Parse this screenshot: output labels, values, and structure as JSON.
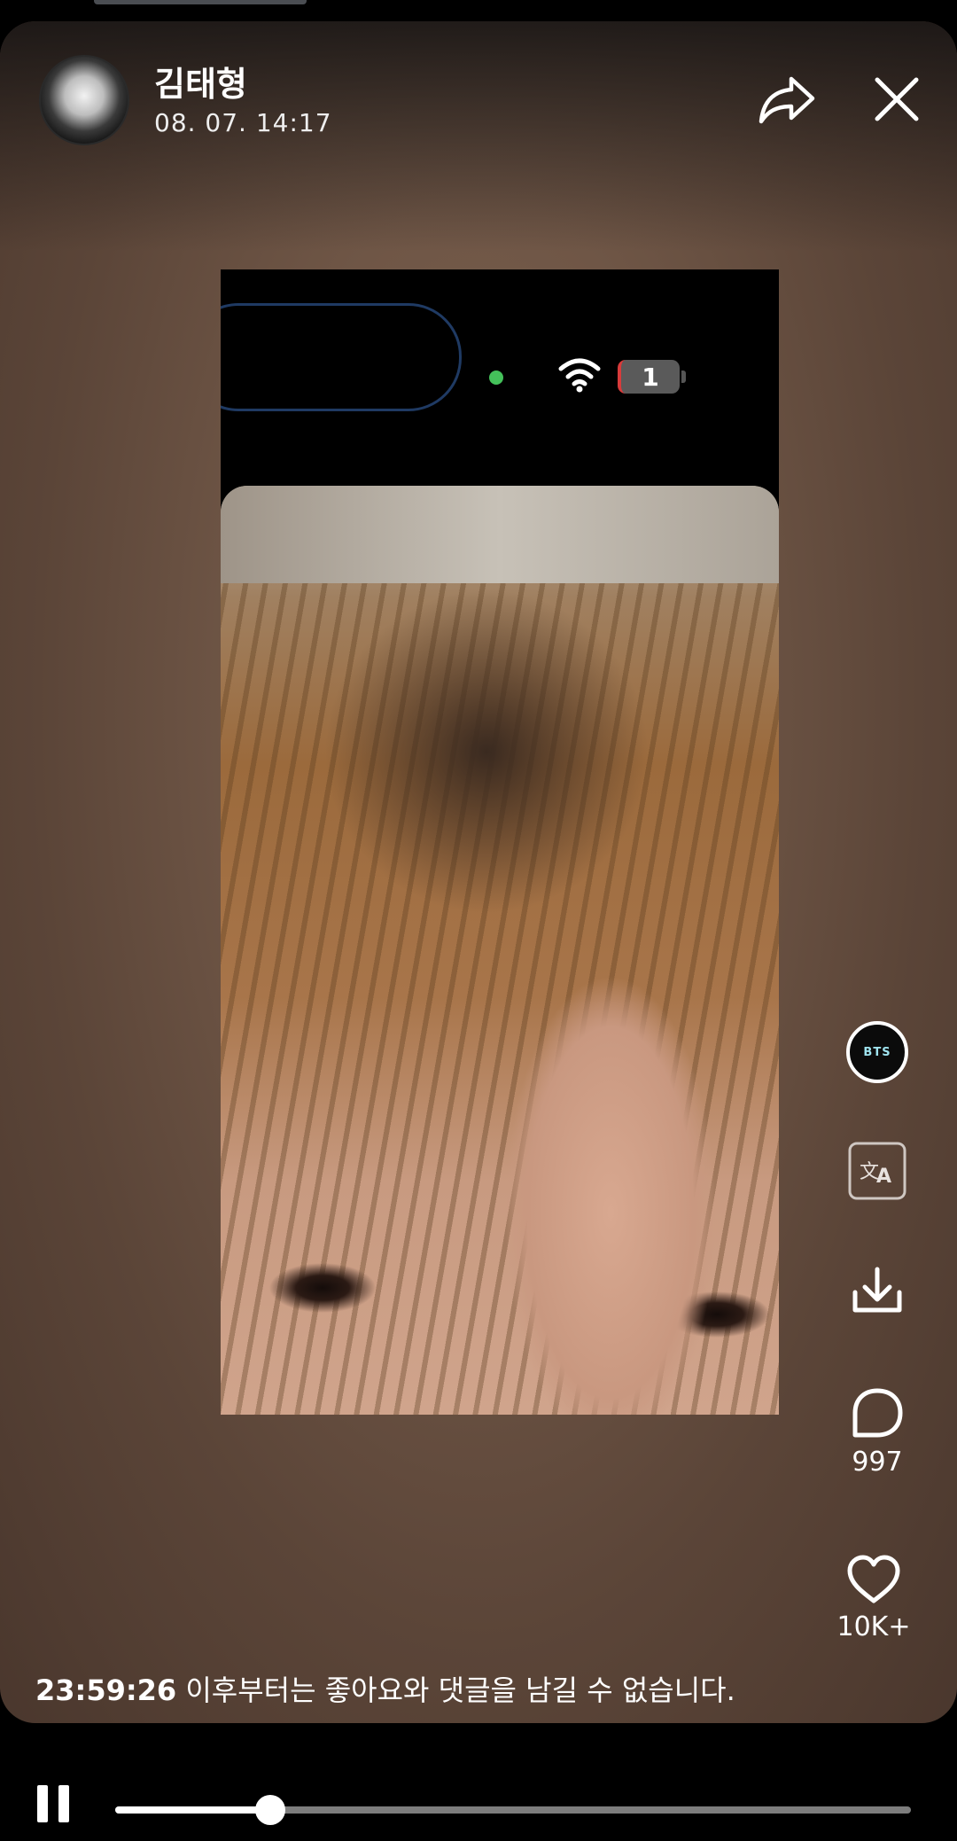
{
  "post": {
    "author": "김태형",
    "time": "08. 07. 14:17"
  },
  "media_status": {
    "notification_count": "1"
  },
  "actions": {
    "badge_label": "BTS",
    "comment_count": "997",
    "like_count": "10K+"
  },
  "notice": {
    "countdown": "23:59:26",
    "text": " 이후부터는 좋아요와 댓글을 남길 수 없습니다."
  },
  "player": {
    "progress": 0.195
  },
  "icons": [
    "share-icon",
    "close-icon",
    "wifi-icon",
    "translate-icon",
    "download-icon",
    "comment-icon",
    "heart-icon",
    "pause-icon"
  ]
}
